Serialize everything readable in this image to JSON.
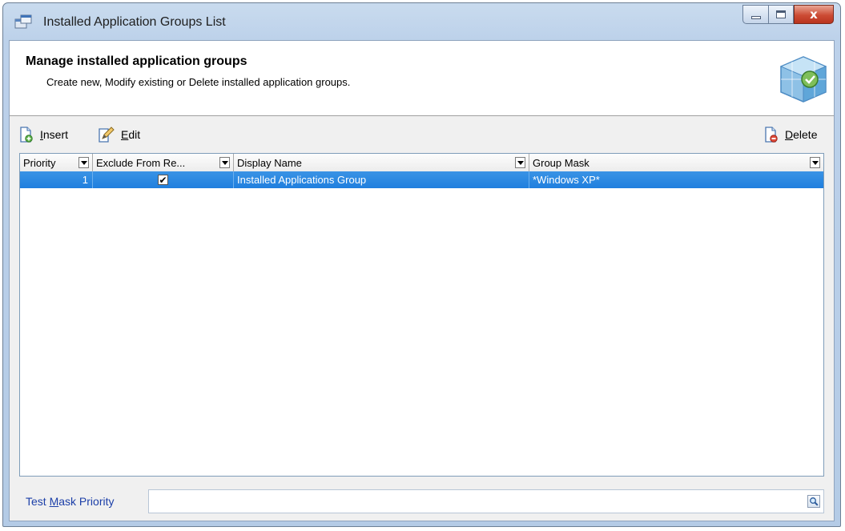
{
  "window": {
    "title": "Installed Application Groups List",
    "close_glyph": "x"
  },
  "header": {
    "title": "Manage installed application groups",
    "description": "Create new, Modify existing or Delete installed application groups.",
    "icon": "application-groups-cube-icon"
  },
  "toolbar": {
    "insert": {
      "first": "I",
      "rest": "nsert",
      "icon": "insert-icon"
    },
    "edit": {
      "first": "E",
      "rest": "dit",
      "icon": "edit-icon"
    },
    "delete": {
      "first": "D",
      "rest": "elete",
      "icon": "delete-icon"
    }
  },
  "grid": {
    "columns": [
      "Priority",
      "Exclude From Re...",
      "Display Name",
      "Group Mask"
    ],
    "rows": [
      {
        "priority": "1",
        "exclude": true,
        "exclude_glyph": "✔",
        "display_name": "Installed Applications Group",
        "group_mask": "*Windows XP*",
        "selected": true
      }
    ]
  },
  "test": {
    "label_pre": "Test ",
    "label_acc": "M",
    "label_post": "ask Priority",
    "value": "",
    "search_icon": "magnifier-icon"
  },
  "colors": {
    "selection": "#2a86e0",
    "link_label": "#1c3fa8"
  }
}
